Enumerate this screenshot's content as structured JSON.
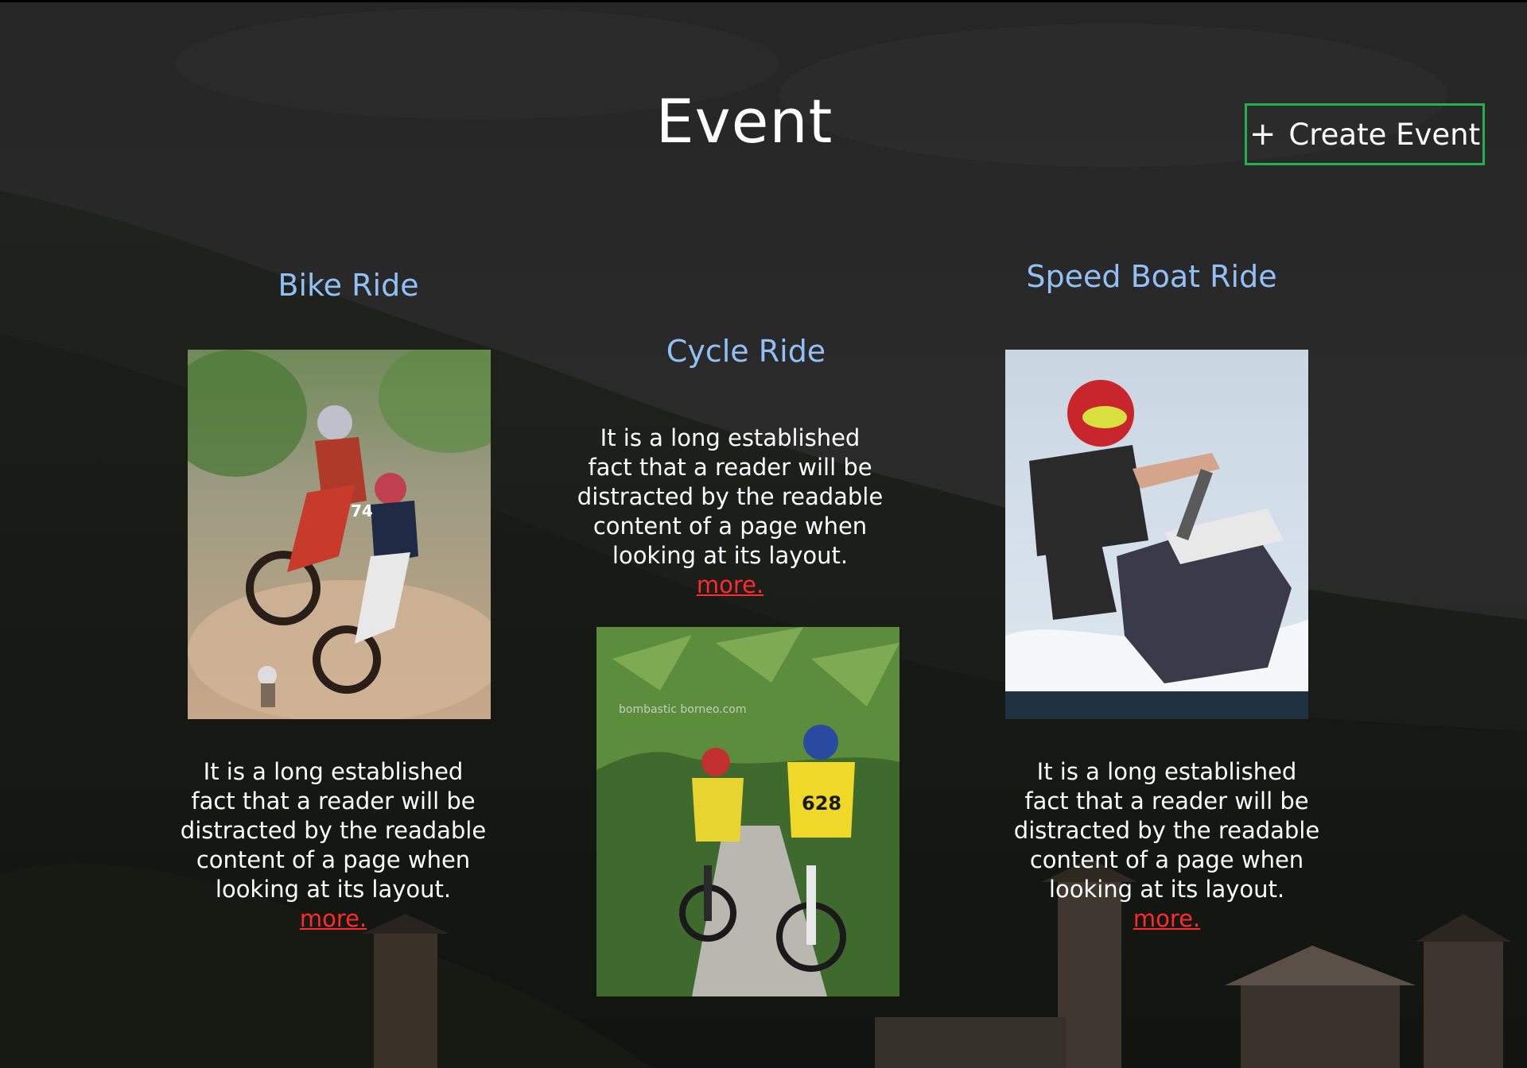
{
  "page": {
    "title": "Event"
  },
  "toolbar": {
    "create_icon": "+",
    "create_label": "Create Event"
  },
  "events": [
    {
      "title": "Bike Ride",
      "photo": "motocross-riders-photo",
      "description": "It is a long established fact that a reader will be distracted by the readable content of a page when looking at its layout.",
      "more_label": "more."
    },
    {
      "title": "Cycle Ride",
      "photo": "mountain-cyclists-photo",
      "photo_watermark": "bombastic borneo.com",
      "description": "It is a long established fact that a reader will be distracted by the readable content of a page when looking at its layout.",
      "more_label": "more."
    },
    {
      "title": "Speed Boat Ride",
      "photo": "jet-ski-rider-photo",
      "description": "It is a long established fact that a reader will be distracted by the readable content of a page when looking at its layout.",
      "more_label": "more."
    }
  ],
  "colors": {
    "accent_title": "#90c0f5",
    "link": "#ff2a2a",
    "button_border": "#27ae4f",
    "background": "#1c1c1c"
  }
}
